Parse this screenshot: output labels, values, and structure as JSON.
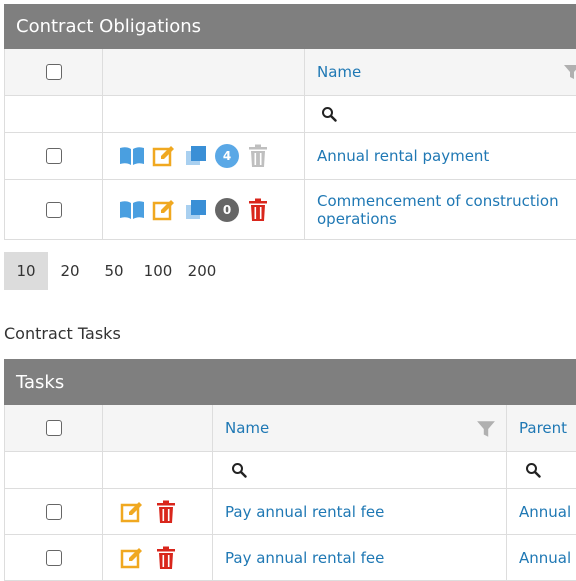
{
  "obligations": {
    "panel_title": "Contract Obligations",
    "name_header": "Name",
    "rows": [
      {
        "name": "Annual rental payment",
        "count": "4",
        "count_color": "#5aa8e6",
        "delete_color": "#bfbfbf"
      },
      {
        "name": "Commencement of construction operations",
        "count": "0",
        "count_color": "#666666",
        "delete_color": "#d9261c"
      }
    ]
  },
  "pager": {
    "sizes": [
      "10",
      "20",
      "50",
      "100",
      "200"
    ],
    "selected": "10"
  },
  "tasks_section_title": "Contract Tasks",
  "tasks": {
    "panel_title": "Tasks",
    "name_header": "Name",
    "parent_header": "Parent",
    "rows": [
      {
        "name": "Pay annual rental fee",
        "parent": "Annual"
      },
      {
        "name": "Pay annual rental fee",
        "parent": "Annual"
      }
    ]
  },
  "colors": {
    "header_bg": "#7f7f7f",
    "link": "#1f78b4",
    "book_icon": "#4a9fe0",
    "edit_icon": "#f0a820",
    "copy_icon": "#3a8fd6",
    "delete_red": "#d9261c",
    "delete_disabled": "#bfbfbf",
    "filter_icon": "#b0b0b0"
  },
  "icons": [
    "book-icon",
    "edit-icon",
    "copy-icon",
    "count-badge",
    "trash-icon",
    "search-icon",
    "filter-icon"
  ]
}
